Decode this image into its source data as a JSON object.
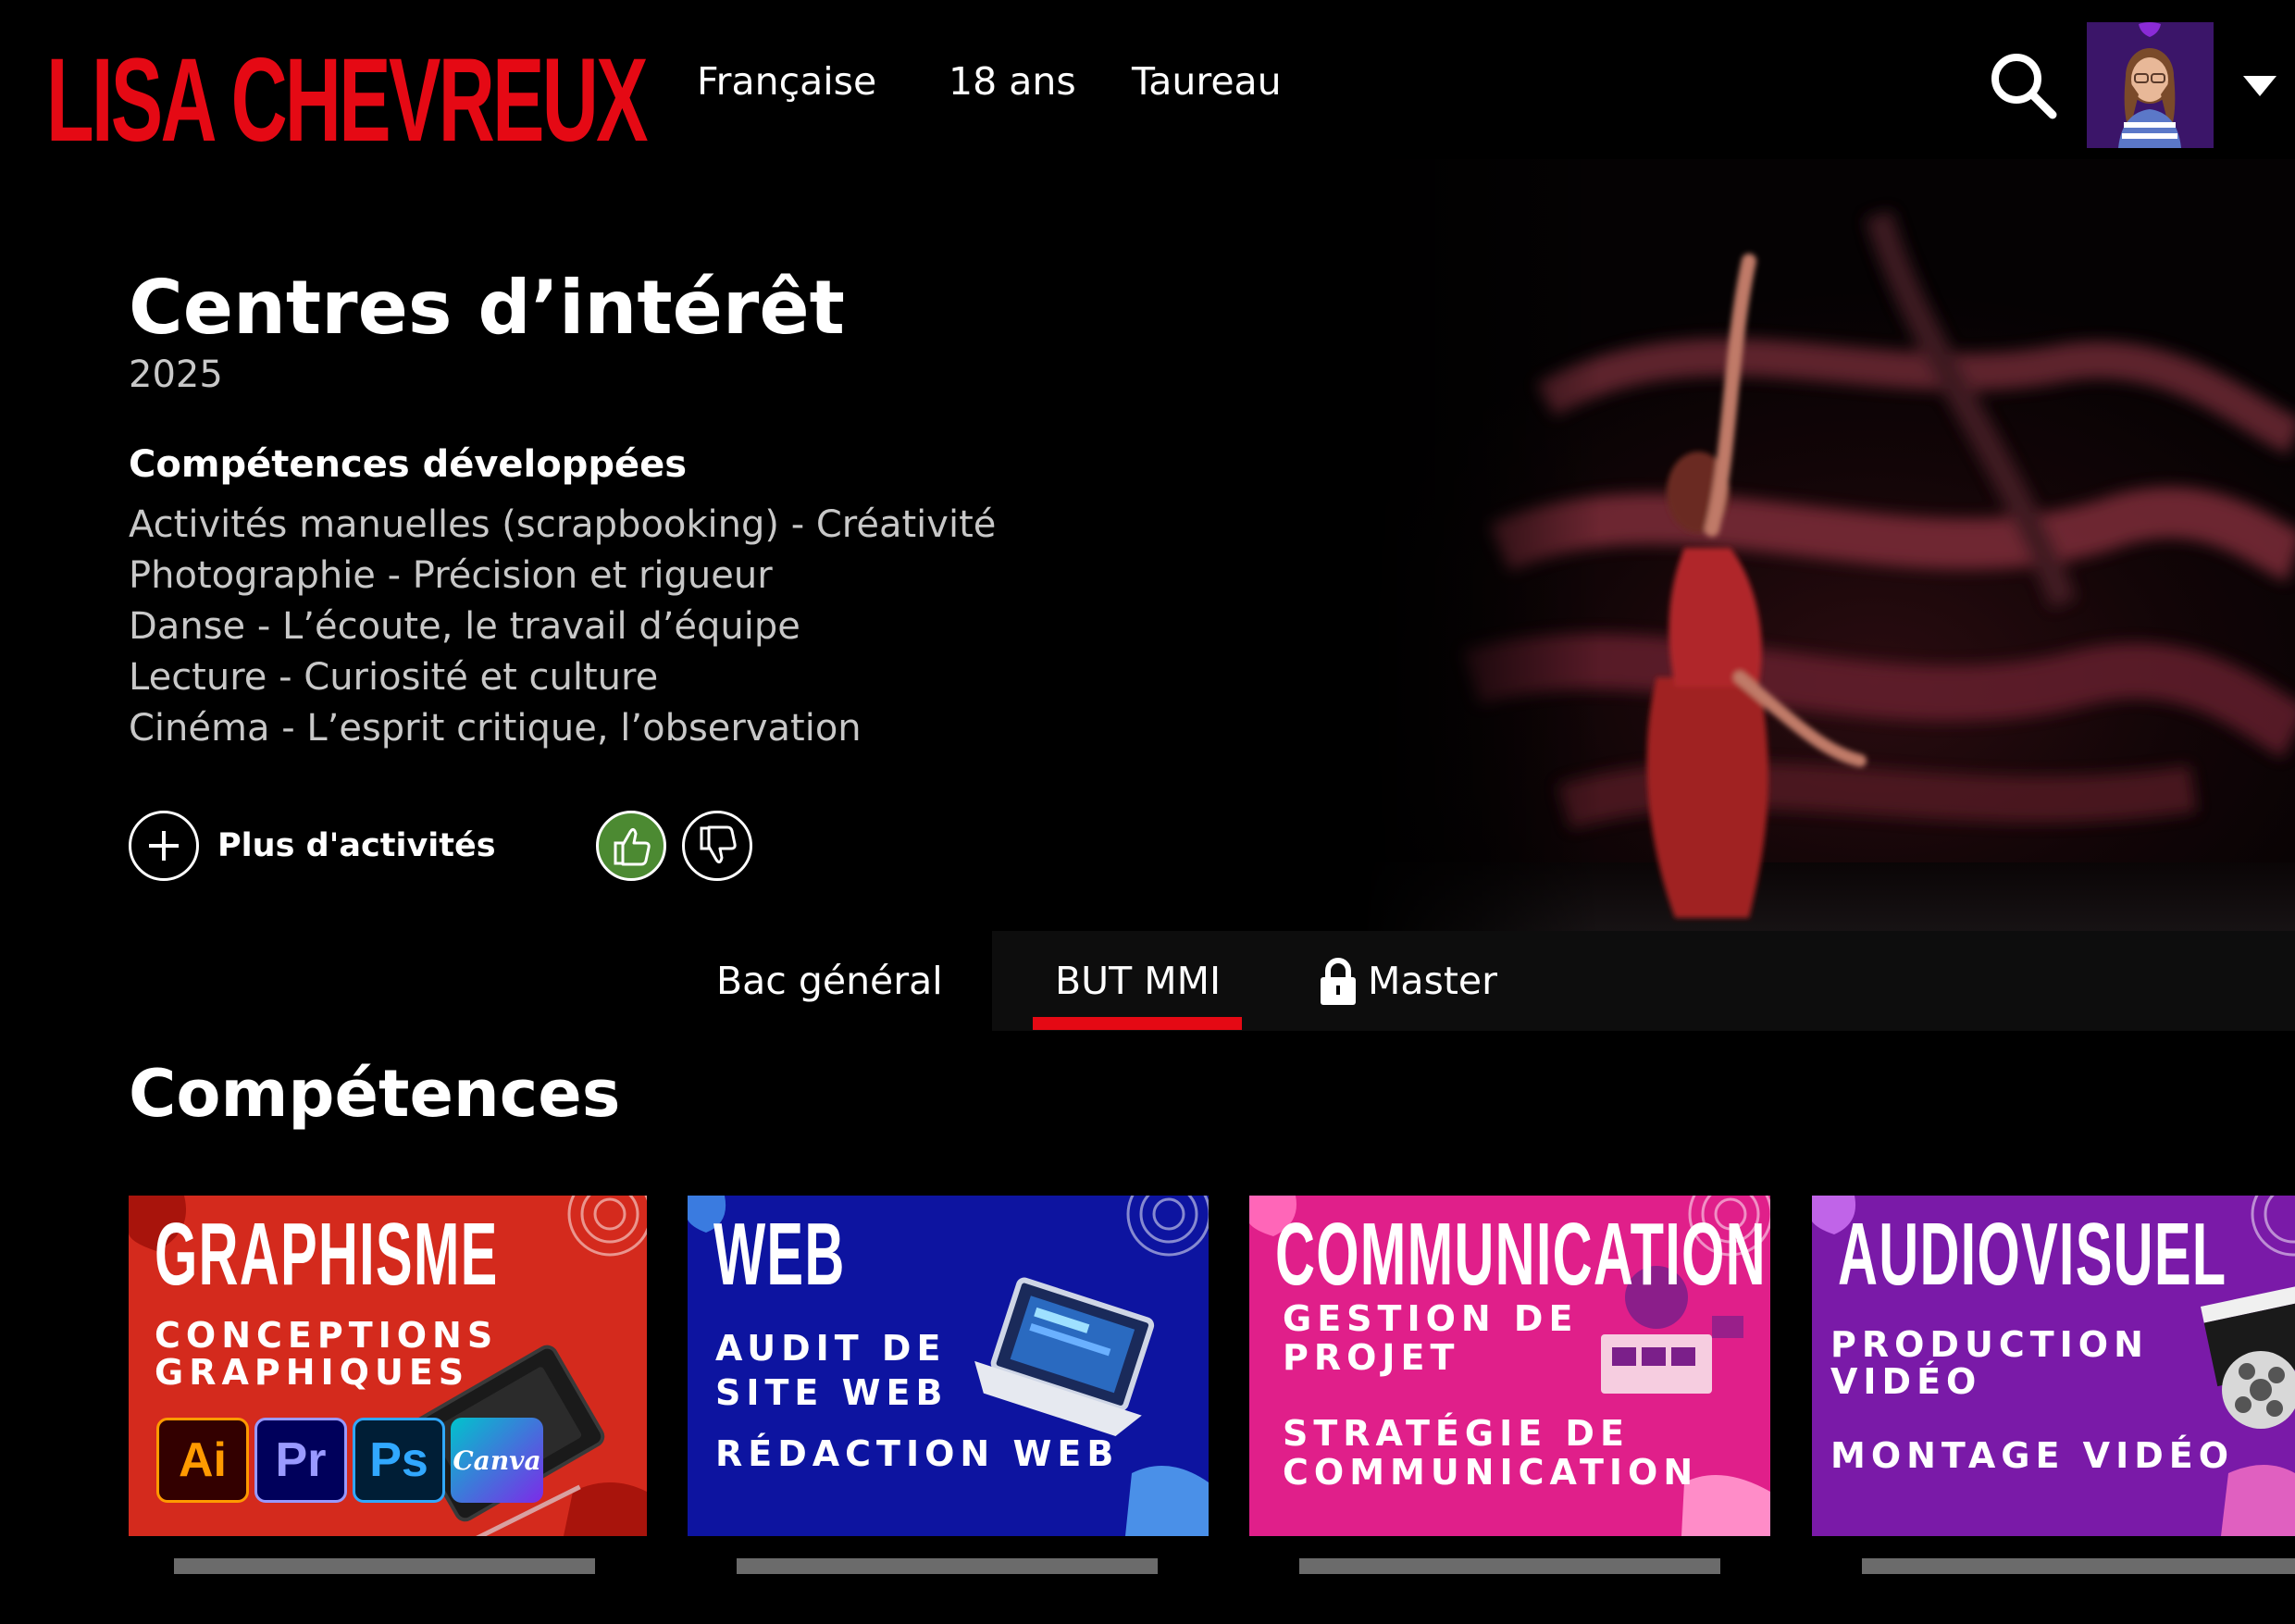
{
  "header": {
    "logo": "LISA CHEVREUX",
    "nav": [
      "Française",
      "18 ans",
      "Taureau"
    ],
    "icons": {
      "search": "search-icon",
      "profile": "avatar",
      "menu": "caret-down-icon"
    }
  },
  "hero": {
    "title": "Centres d’intérêt",
    "year": "2025",
    "skills_heading": "Compétences développées",
    "activities": [
      "Activités manuelles (scrapbooking) - Créativité",
      "Photographie - Précision et rigueur",
      "Danse - L’écoute, le travail d’équipe",
      "Lecture - Curiosité et culture",
      "Cinéma - L’esprit critique, l’observation"
    ],
    "more_label": "Plus d'activités",
    "like_state": "liked"
  },
  "tabs": {
    "items": [
      {
        "label": "Bac général",
        "active": false,
        "locked": false
      },
      {
        "label": "BUT MMI",
        "active": true,
        "locked": false
      },
      {
        "label": "Master",
        "active": false,
        "locked": true
      }
    ]
  },
  "section": {
    "title": "Compétences"
  },
  "cards": [
    {
      "title": "GRAPHISME",
      "lines": [
        "CONCEPTIONS",
        "GRAPHIQUES"
      ],
      "tools": [
        "Ai",
        "Pr",
        "Ps",
        "Canva"
      ],
      "color": "#d42a1d"
    },
    {
      "title": "WEB",
      "lines": [
        "AUDIT DE",
        "SITE WEB",
        "RÉDACTION WEB"
      ],
      "color": "#0d14a0"
    },
    {
      "title": "COMMUNICATION",
      "lines": [
        "GESTION DE",
        "PROJET",
        "STRATÉGIE DE",
        "COMMUNICATION"
      ],
      "color": "#e01f8a"
    },
    {
      "title": "AUDIOVISUEL",
      "lines": [
        "PRODUCTION",
        "VIDÉO",
        "MONTAGE VIDÉO"
      ],
      "color": "#7a1aa8"
    }
  ],
  "colors": {
    "accent": "#e50914",
    "like": "#4c8a32"
  }
}
